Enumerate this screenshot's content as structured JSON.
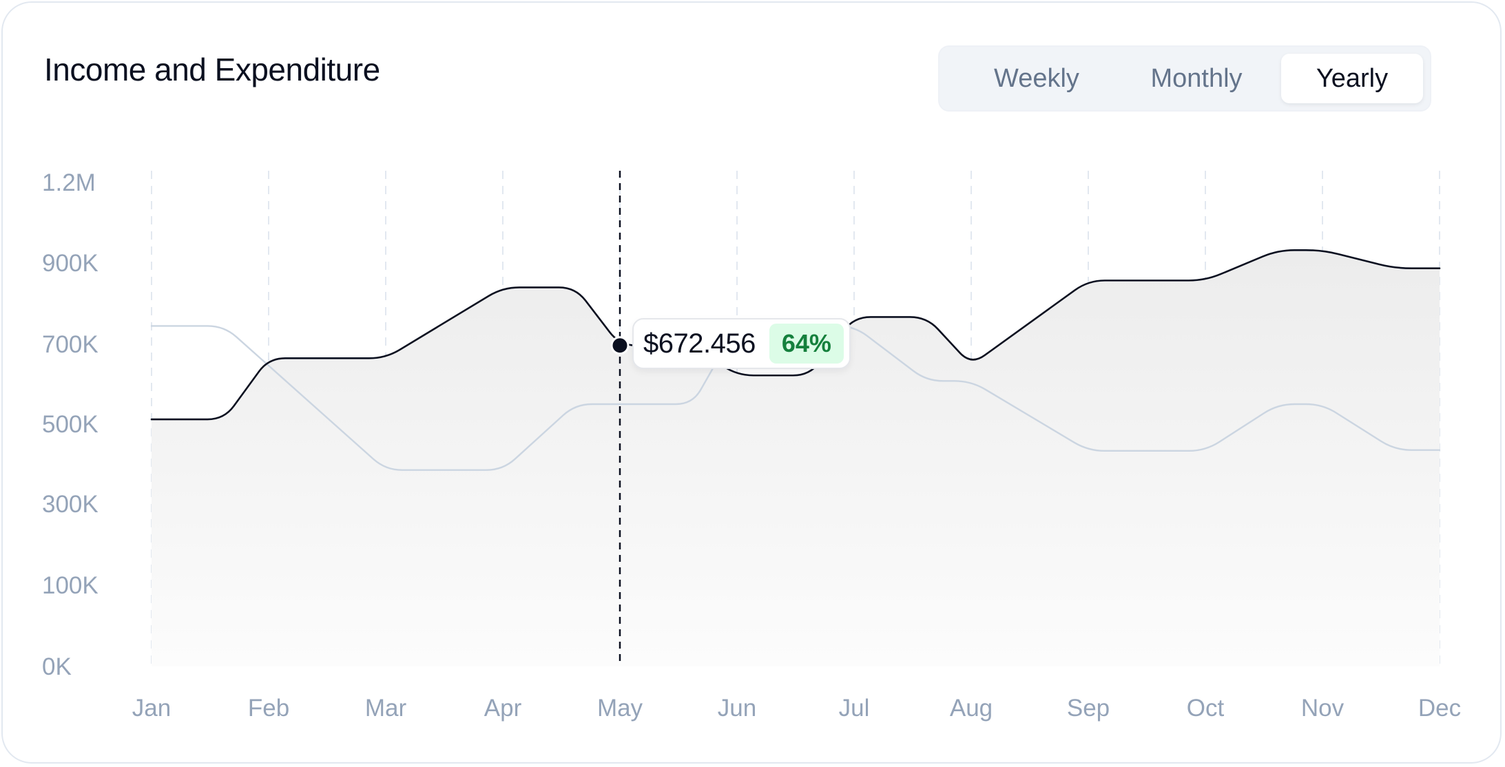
{
  "card": {
    "title": "Income and Expenditure"
  },
  "toggle": {
    "options": [
      "Weekly",
      "Monthly",
      "Yearly"
    ],
    "selected": "Yearly"
  },
  "tooltip": {
    "month": "May",
    "value": "$672.456",
    "badge": "64%"
  },
  "colors": {
    "income_line": "#0b1020",
    "expenditure_line": "#cbd5e1",
    "badge_bg": "#dcfce7",
    "badge_text": "#15803d",
    "axis_text": "#94a3b8",
    "gridline": "#e2e8f0"
  },
  "chart_data": {
    "type": "line",
    "title": "Income and Expenditure",
    "categories": [
      "Jan",
      "Feb",
      "Mar",
      "Apr",
      "May",
      "Jun",
      "Jul",
      "Aug",
      "Sep",
      "Oct",
      "Nov",
      "Dec"
    ],
    "y_tick_labels": [
      "0K",
      "100K",
      "300K",
      "500K",
      "700K",
      "900K",
      "1.2M"
    ],
    "gridlines": "vertical, dashed",
    "area_fill": "under dark series, gradient",
    "series": [
      {
        "points": [
          [
            "Jan",
            512
          ],
          [
            "Jan+",
            512
          ],
          [
            "Feb",
            665
          ],
          [
            "Mar",
            665
          ],
          [
            "Apr",
            840
          ],
          [
            "Apr+",
            840
          ],
          [
            "May",
            697
          ],
          [
            "May+",
            697
          ],
          [
            "Jun",
            622
          ],
          [
            "Jun+",
            622
          ],
          [
            "Jul",
            767
          ],
          [
            "Jul+",
            767
          ],
          [
            "Aug",
            648
          ],
          [
            "Sep",
            857
          ],
          [
            "Oct",
            857
          ],
          [
            "Oct+",
            948
          ],
          [
            "Nov",
            948
          ],
          [
            "Nov+",
            887
          ],
          [
            "Dec",
            887
          ]
        ]
      },
      {
        "points": [
          [
            "Jan",
            745
          ],
          [
            "Jan+",
            745
          ],
          [
            "Mar",
            385
          ],
          [
            "Apr",
            385
          ],
          [
            "Apr+",
            550
          ],
          [
            "May",
            550
          ],
          [
            "May+",
            550
          ],
          [
            "Jun",
            745
          ],
          [
            "Jul",
            745
          ],
          [
            "Jul+",
            608
          ],
          [
            "Aug",
            608
          ],
          [
            "Sep",
            433
          ],
          [
            "Oct",
            433
          ],
          [
            "Oct+",
            550
          ],
          [
            "Nov",
            550
          ],
          [
            "Nov+",
            435
          ],
          [
            "Dec",
            435
          ]
        ]
      }
    ]
  }
}
